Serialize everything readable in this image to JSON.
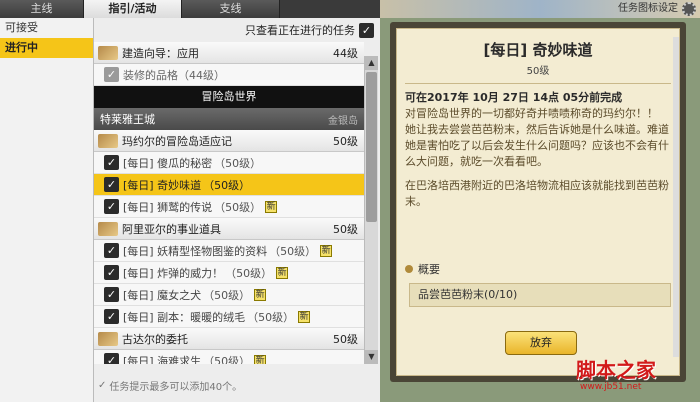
{
  "tabs": [
    {
      "label": "主线"
    },
    {
      "label": "指引/活动",
      "active": true
    },
    {
      "label": "支线"
    }
  ],
  "header": {
    "icon_settings_label": "任务图标设定"
  },
  "categories": [
    {
      "label": "可接受"
    },
    {
      "label": "进行中",
      "active": true
    }
  ],
  "filter": {
    "label": "只查看正在进行的任务",
    "checked": true
  },
  "groups": [
    {
      "title": "建造向导：应用",
      "level": "44级",
      "items": [
        {
          "label": "装修的品格（44级）",
          "done": true
        }
      ]
    }
  ],
  "region_bar": "冒险岛世界",
  "section": {
    "title": "特莱雅王城",
    "sub": "金银岛"
  },
  "groups2": [
    {
      "title": "玛约尔的冒险岛适应记",
      "level": "50级",
      "items": [
        {
          "label": "[每日] 傻瓜的秘密",
          "lv": "（50级）"
        },
        {
          "label": "[每日] 奇妙味道",
          "lv": "（50级）",
          "active": true
        },
        {
          "label": "[每日] 狮鹫的传说",
          "lv": "（50级）",
          "new": "新"
        }
      ]
    },
    {
      "title": "阿里亚尔的事业道具",
      "level": "50级",
      "items": [
        {
          "label": "[每日] 妖精型怪物图鉴的资料",
          "lv": "（50级）",
          "new": "新"
        },
        {
          "label": "[每日] 炸弹的威力！",
          "lv": "（50级）",
          "new": "新"
        },
        {
          "label": "[每日] 魔女之犬",
          "lv": "（50级）",
          "new": "新"
        },
        {
          "label": "[每日] 副本：暖暖的绒毛",
          "lv": "（50级）",
          "new": "新"
        }
      ]
    },
    {
      "title": "古达尔的委托",
      "level": "50级",
      "items": [
        {
          "label": "[每日] 海难求生",
          "lv": "（50级）",
          "new": "新"
        }
      ]
    }
  ],
  "footnote": "任务提示最多可以添加40个。",
  "detail": {
    "title": "[每日] 奇妙味道",
    "level": "50级",
    "time": "可在2017年 10月 27日 14点 05分前完成",
    "para1": "对冒险岛世界的一切都好奇并啧啧称奇的玛约尔！！",
    "para2": "她让我去尝尝芭芭粉末，然后告诉她是什么味道。难道她是害怕吃了以后会发生什么问题吗？应该也不会有什么大问题，就吃一次看看吧。",
    "para3": "在巴洛培西港附近的巴洛培物流相应该就能找到芭芭粉末。",
    "summary_label": "概要",
    "goal": "品尝芭芭粉末(0/10)",
    "abandon_label": "放弃"
  },
  "watermark": {
    "main": "脚本之家",
    "sub": "www.jb51.net"
  }
}
